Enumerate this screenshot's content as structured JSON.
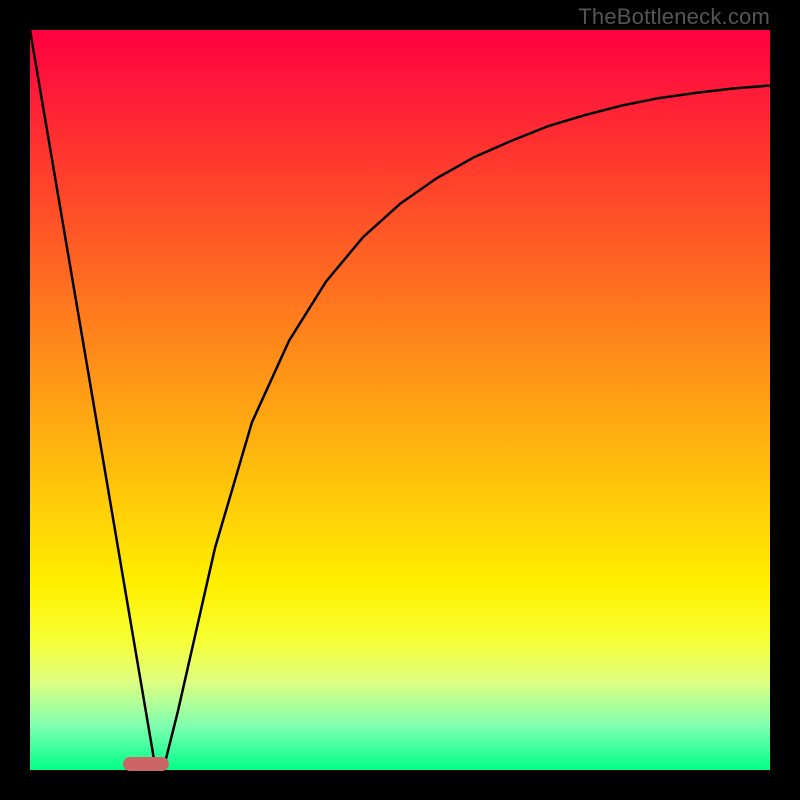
{
  "watermark": "TheBottleneck.com",
  "colors": {
    "frame": "#000000",
    "gradient_top": "#ff0040",
    "gradient_bottom": "#00ff88",
    "marker": "#cc6666",
    "curve": "#000000"
  },
  "chart_data": {
    "type": "line",
    "title": "",
    "xlabel": "",
    "ylabel": "",
    "xlim": [
      0,
      100
    ],
    "ylim": [
      0,
      100
    ],
    "grid": false,
    "series": [
      {
        "name": "curve",
        "x": [
          0,
          5,
          10,
          13,
          16,
          17,
          18,
          20,
          25,
          30,
          35,
          40,
          45,
          50,
          55,
          60,
          65,
          70,
          75,
          80,
          85,
          90,
          95,
          100
        ],
        "y": [
          100,
          70.6,
          41.2,
          23.5,
          5.9,
          0,
          0,
          8,
          30,
          47,
          58,
          66,
          72,
          76.5,
          80,
          82.8,
          85,
          87,
          88.5,
          89.8,
          90.8,
          91.5,
          92.1,
          92.5
        ]
      }
    ],
    "marker": {
      "x_start": 13,
      "x_end": 18,
      "y": 0
    },
    "axes_visible": false
  }
}
